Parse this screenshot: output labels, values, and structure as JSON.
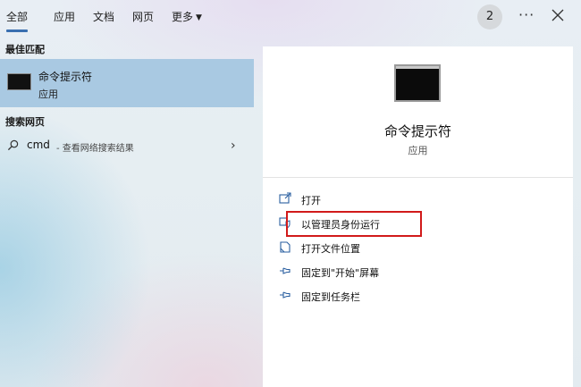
{
  "tabs": [
    {
      "label": "全部",
      "active": true
    },
    {
      "label": "应用"
    },
    {
      "label": "文档"
    },
    {
      "label": "网页"
    },
    {
      "label": "更多"
    }
  ],
  "badge": "2",
  "more_glyph": "···",
  "sections": {
    "best_match": "最佳匹配",
    "search_web": "搜索网页"
  },
  "best_match_item": {
    "title": "命令提示符",
    "subtitle": "应用",
    "icon": "cmd-icon"
  },
  "web_result": {
    "query": "cmd",
    "hint": "- 查看网络搜索结果",
    "icon": "search-icon"
  },
  "panel": {
    "title": "命令提示符",
    "subtitle": "应用",
    "actions": [
      {
        "label": "打开",
        "icon": "open-icon"
      },
      {
        "label": "以管理员身份运行",
        "icon": "shield-run-icon"
      },
      {
        "label": "打开文件位置",
        "icon": "file-location-icon"
      },
      {
        "label": "固定到\"开始\"屏幕",
        "icon": "pin-icon"
      },
      {
        "label": "固定到任务栏",
        "icon": "pin-icon"
      }
    ]
  },
  "colors": {
    "accent": "#3a6fb0",
    "selected": "#a9c9e2",
    "highlight": "#d11a1a"
  }
}
